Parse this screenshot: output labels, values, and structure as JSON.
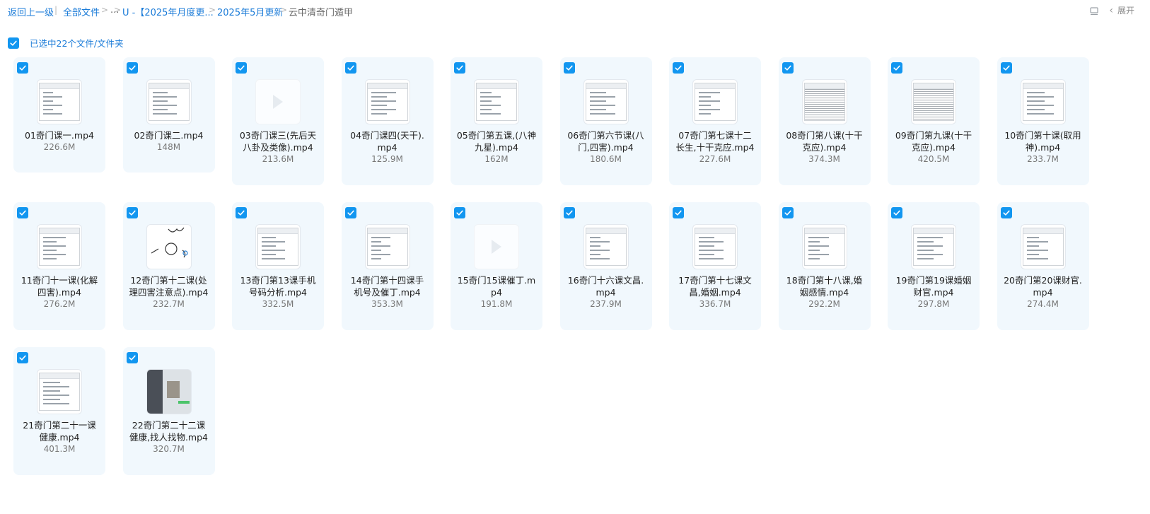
{
  "breadcrumb": {
    "back": "返回上一级",
    "sep1": "|",
    "all_files": "全部文件",
    "ellipsis": "...",
    "folder1": "U -【2025年月度更...",
    "folder2": "2025年5月更新",
    "current": "云中清奇门遁甲",
    "expand": "展开"
  },
  "selection": {
    "text": "已选中22个文件/文件夹"
  },
  "accent_color": "#1296f0",
  "files": [
    {
      "name": "01奇门课一.mp4",
      "size": "226.6M",
      "thumb": "doc"
    },
    {
      "name": "02奇门课二.mp4",
      "size": "148M",
      "thumb": "table"
    },
    {
      "name": "03奇门课三(先后天八卦及类像).mp4",
      "size": "213.6M",
      "thumb": "blank"
    },
    {
      "name": "04奇门课四(天干).mp4",
      "size": "125.9M",
      "thumb": "doc"
    },
    {
      "name": "05奇门第五课,(八神九星).mp4",
      "size": "162M",
      "thumb": "doc"
    },
    {
      "name": "06奇门第六节课(八门,四害).mp4",
      "size": "180.6M",
      "thumb": "doc"
    },
    {
      "name": "07奇门第七课十二长生,十干克应.mp4",
      "size": "227.6M",
      "thumb": "doc"
    },
    {
      "name": "08奇门第八课(十干克应).mp4",
      "size": "374.3M",
      "thumb": "dense"
    },
    {
      "name": "09奇门第九课(十干克应).mp4",
      "size": "420.5M",
      "thumb": "dense"
    },
    {
      "name": "10奇门第十课(取用神).mp4",
      "size": "233.7M",
      "thumb": "doc"
    },
    {
      "name": "11奇门十一课(化解四害).mp4",
      "size": "276.2M",
      "thumb": "doc"
    },
    {
      "name": "12奇门第十二课(处理四害注意点).mp4",
      "size": "232.7M",
      "thumb": "sketch"
    },
    {
      "name": "13奇门第13课手机号码分析.mp4",
      "size": "332.5M",
      "thumb": "doc"
    },
    {
      "name": "14奇门第十四课手机号及催丁.mp4",
      "size": "353.3M",
      "thumb": "doc"
    },
    {
      "name": "15奇门15课催丁.mp4",
      "size": "191.8M",
      "thumb": "blank"
    },
    {
      "name": "16奇门十六课文昌.mp4",
      "size": "237.9M",
      "thumb": "doc"
    },
    {
      "name": "17奇门第十七课文昌,婚姻.mp4",
      "size": "336.7M",
      "thumb": "doc"
    },
    {
      "name": "18奇门第十八课,婚姻感情.mp4",
      "size": "292.2M",
      "thumb": "doc"
    },
    {
      "name": "19奇门第19课婚姻财官.mp4",
      "size": "297.8M",
      "thumb": "doc"
    },
    {
      "name": "20奇门第20课财官.mp4",
      "size": "274.4M",
      "thumb": "doc"
    },
    {
      "name": "21奇门第二十一课健康.mp4",
      "size": "401.3M",
      "thumb": "doc"
    },
    {
      "name": "22奇门第二十二课健康,找人找物.mp4",
      "size": "320.7M",
      "thumb": "phone"
    }
  ]
}
